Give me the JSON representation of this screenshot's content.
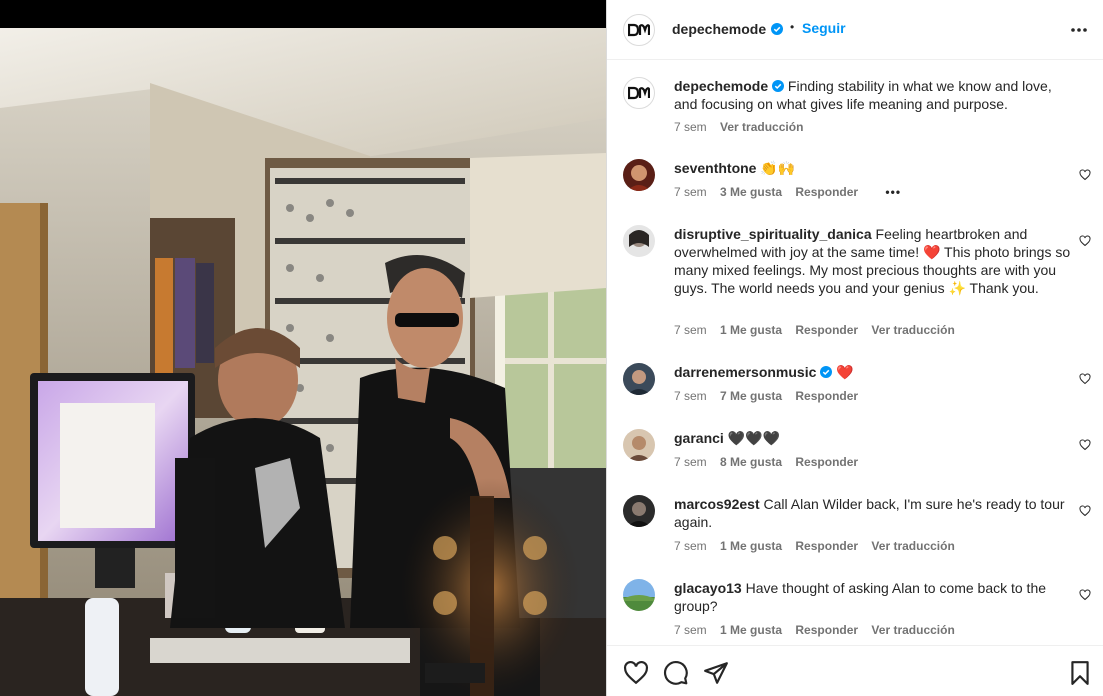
{
  "post": {
    "username": "depechemode",
    "follow_label": "Seguir",
    "separator": "•"
  },
  "caption": {
    "username": "depechemode",
    "text": "Finding stability in what we know and love, and focusing on what gives life meaning and purpose.",
    "time": "7 sem",
    "translate": "Ver traducción"
  },
  "comments": [
    {
      "username": "seventhtone",
      "text": "👏🙌",
      "time": "7 sem",
      "likes": "3 Me gusta",
      "reply": "Responder",
      "extra": "•••"
    },
    {
      "username": "disruptive_spirituality_danica",
      "text": "Feeling heartbroken and overwhelmed with joy at the same time! ❤️ This photo brings so many mixed feelings. My most precious thoughts are with you guys. The world needs you and your genius ✨ Thank you.",
      "time": "7 sem",
      "likes": "1 Me gusta",
      "reply": "Responder",
      "translate": "Ver traducción"
    },
    {
      "username": "darrenemersonmusic",
      "text": "❤️",
      "time": "7 sem",
      "likes": "7 Me gusta",
      "reply": "Responder"
    },
    {
      "username": "garanci",
      "text": "🖤🖤🖤",
      "time": "7 sem",
      "likes": "8 Me gusta",
      "reply": "Responder"
    },
    {
      "username": "marcos92est",
      "text": "Call Alan Wilder back, I'm sure he's ready to tour again.",
      "time": "7 sem",
      "likes": "1 Me gusta",
      "reply": "Responder",
      "translate": "Ver traducción"
    },
    {
      "username": "glacayo13",
      "text": "Have thought of asking Alan to come back to the group?",
      "time": "7 sem",
      "likes": "1 Me gusta",
      "reply": "Responder",
      "translate": "Ver traducción"
    }
  ],
  "icons": {
    "like": "heart-icon",
    "comment": "comment-icon",
    "share": "send-icon",
    "save": "bookmark-icon",
    "more": "more-options-icon",
    "verified": "verified-badge-icon"
  },
  "colors": {
    "accent": "#0095f6",
    "verified": "#0095f6",
    "muted": "#737373"
  }
}
